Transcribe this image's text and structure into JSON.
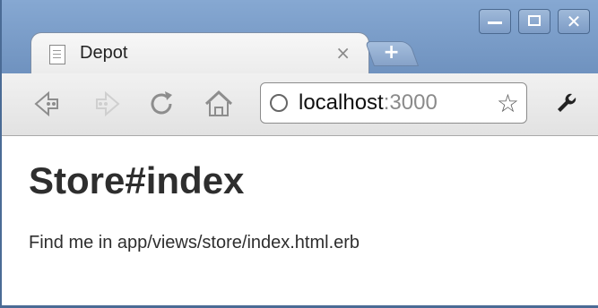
{
  "tab": {
    "title": "Depot",
    "close": "×"
  },
  "new_tab": {
    "label": "+"
  },
  "window_controls": {
    "close": "✕"
  },
  "toolbar": {
    "back_icon": "back-arrow-icon",
    "forward_icon": "forward-arrow-icon",
    "reload_icon": "reload-icon",
    "home_icon": "home-icon",
    "star_icon": "star-icon",
    "wrench_icon": "wrench-icon"
  },
  "omnibox": {
    "host": "localhost",
    "port": ":3000"
  },
  "page": {
    "heading": "Store#index",
    "text": "Find me in app/views/store/index.html.erb"
  },
  "colors": {
    "frame": "#4a6b95",
    "titlebar": "#7d9cc6",
    "toolbar": "#e8e8e8"
  }
}
